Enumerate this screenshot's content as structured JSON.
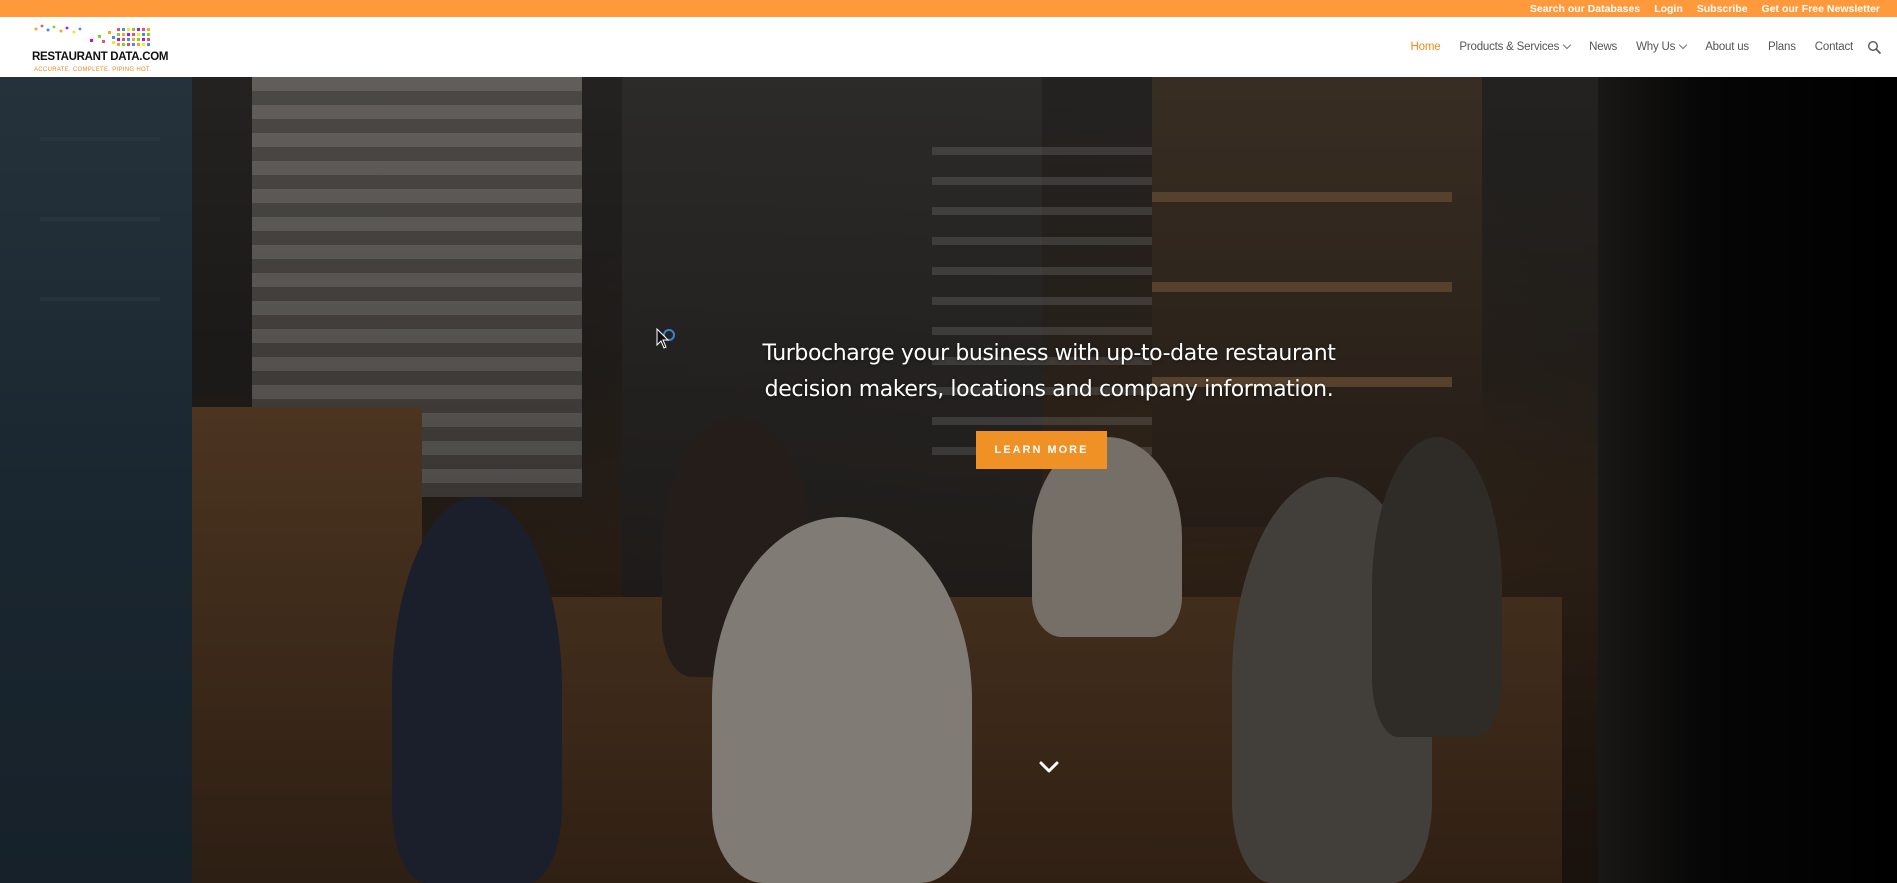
{
  "topbar": {
    "links": [
      "Search our Databases",
      "Login",
      "Subscribe",
      "Get our Free Newsletter"
    ]
  },
  "logo": {
    "name": "RESTAURANT DATA.COM",
    "tagline": "ACCURATE. COMPLETE. PIPING HOT."
  },
  "nav": {
    "items": [
      {
        "label": "Home",
        "active": true
      },
      {
        "label": "Products & Services",
        "dropdown": true
      },
      {
        "label": "News"
      },
      {
        "label": "Why Us",
        "dropdown": true
      },
      {
        "label": "About us"
      },
      {
        "label": "Plans"
      },
      {
        "label": "Contact"
      }
    ]
  },
  "hero": {
    "headline_line1": "Turbocharge your business with up-to-date restaurant",
    "headline_line2": "decision makers, locations and company information.",
    "button_label": "LEARN MORE"
  },
  "colors": {
    "accent": "#f09125",
    "topbar": "#ff9a3c",
    "nav_active": "#f08a1c"
  },
  "icons": [
    "search-icon",
    "chevron-down-icon",
    "scroll-down-arrow-icon",
    "mouse-cursor-icon"
  ]
}
